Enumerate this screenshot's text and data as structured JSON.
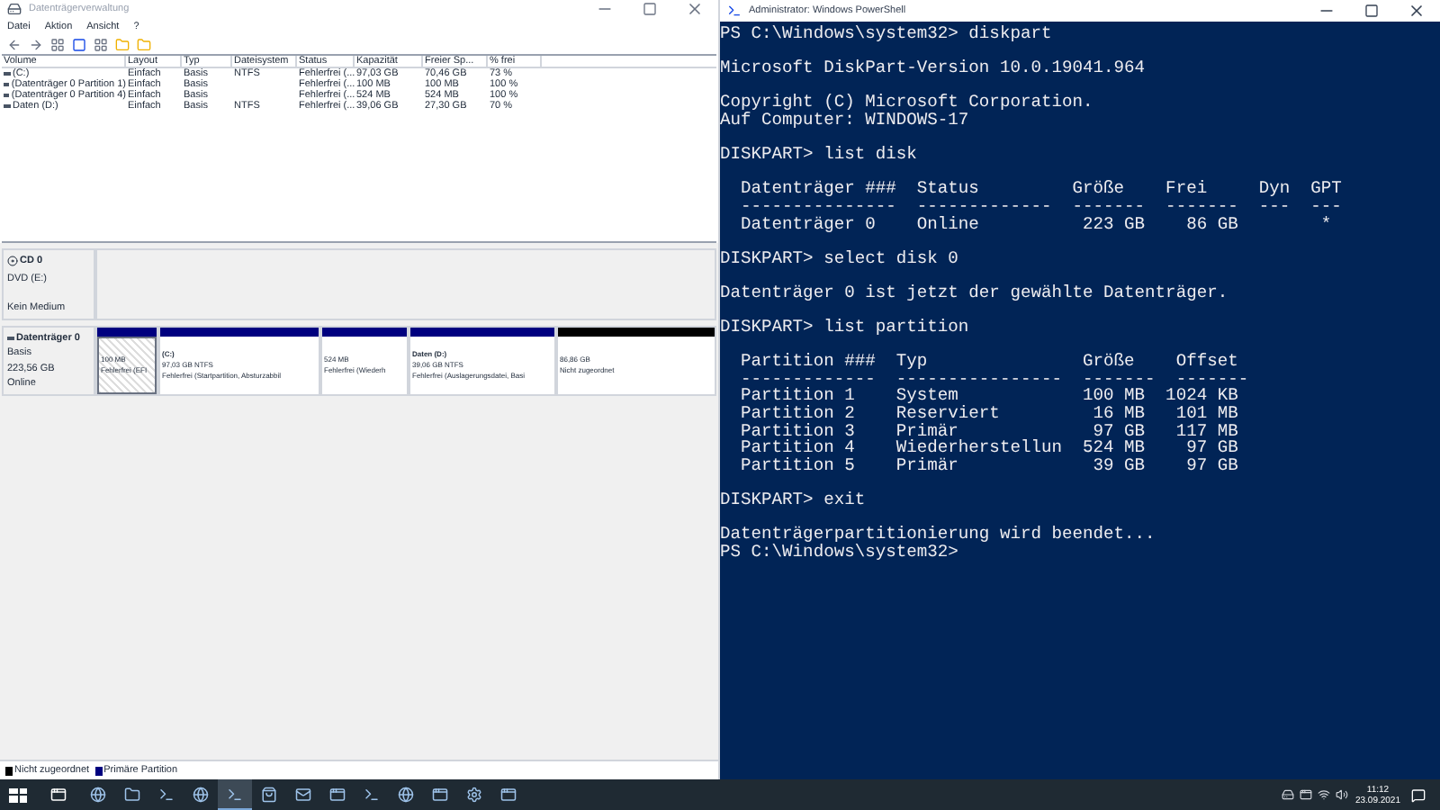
{
  "disk_management": {
    "title": "Datenträgerverwaltung",
    "menu": [
      "Datei",
      "Aktion",
      "Ansicht",
      "?"
    ],
    "columns": [
      "Volume",
      "Layout",
      "Typ",
      "Dateisystem",
      "Status",
      "Kapazität",
      "Freier Sp...",
      "% frei"
    ],
    "rows": [
      [
        "(C:)",
        "Einfach",
        "Basis",
        "NTFS",
        "Fehlerfrei (...",
        "97,03 GB",
        "70,46 GB",
        "73 %"
      ],
      [
        "(Datenträger 0 Partition 1)",
        "Einfach",
        "Basis",
        "",
        "Fehlerfrei (...",
        "100 MB",
        "100 MB",
        "100 %"
      ],
      [
        "(Datenträger 0 Partition 4)",
        "Einfach",
        "Basis",
        "",
        "Fehlerfrei (...",
        "524 MB",
        "524 MB",
        "100 %"
      ],
      [
        "Daten (D:)",
        "Einfach",
        "Basis",
        "NTFS",
        "Fehlerfrei (...",
        "39,06 GB",
        "27,30 GB",
        "70 %"
      ]
    ],
    "disks": [
      {
        "kind": "cd",
        "name": "CD 0",
        "lines": [
          "DVD (E:)",
          "Kein Medium"
        ]
      },
      {
        "kind": "disk",
        "name": "Datenträger 0",
        "lines": [
          "Basis",
          "223,56 GB",
          "Online"
        ],
        "partitions": [
          {
            "selected": true,
            "color": "#00007f",
            "lines": [
              "100 MB",
              "Fehlerfrei (EFI"
            ]
          },
          {
            "selected": false,
            "color": "#00007f",
            "title": "(C:)",
            "lines": [
              "97,03 GB NTFS",
              "Fehlerfrei (Startpartition, Absturzabbil"
            ]
          },
          {
            "selected": false,
            "color": "#00007f",
            "lines": [
              "524 MB",
              "Fehlerfrei (Wiederh"
            ]
          },
          {
            "selected": false,
            "color": "#00007f",
            "title": "Daten (D:)",
            "lines": [
              "39,06 GB NTFS",
              "Fehlerfrei (Auslagerungsdatei, Basi"
            ]
          },
          {
            "selected": false,
            "color": "#000000",
            "lines": [
              "86,86 GB",
              "Nicht zugeordnet"
            ]
          }
        ]
      }
    ],
    "legend": [
      {
        "label": "Nicht zugeordnet",
        "color": "#000000"
      },
      {
        "label": "Primäre Partition",
        "color": "#00007f"
      }
    ]
  },
  "powershell": {
    "title": "Administrator: Windows PowerShell",
    "blocks": [
      [
        "PS C:\\Windows\\system32> diskpart"
      ],
      [
        "Microsoft DiskPart-Version 10.0.19041.964"
      ],
      [
        "Copyright (C) Microsoft Corporation.",
        "Auf Computer: WINDOWS-17"
      ],
      [
        "DISKPART> list disk"
      ],
      [
        "  Datenträger ###  Status         Größe    Frei     Dyn  GPT",
        "  ---------------  -------------  -------  -------  ---  ---",
        "  Datenträger 0    Online          223 GB    86 GB        *"
      ],
      [
        "DISKPART> select disk 0"
      ],
      [
        "Datenträger 0 ist jetzt der gewählte Datenträger."
      ],
      [
        "DISKPART> list partition"
      ],
      [
        "  Partition ###  Typ               Größe    Offset",
        "  -------------  ----------------  -------  -------",
        "  Partition 1    System            100 MB  1024 KB",
        "  Partition 2    Reserviert         16 MB   101 MB",
        "  Partition 3    Primär             97 GB   117 MB",
        "  Partition 4    Wiederherstellun  524 MB    97 GB",
        "  Partition 5    Primär             39 GB    97 GB"
      ],
      [
        "DISKPART> exit"
      ],
      [
        "Datenträgerpartitionierung wird beendet...",
        "PS C:\\Windows\\system32>"
      ]
    ]
  },
  "taskbar": {
    "apps": [
      {
        "kind": "browser",
        "selected": false
      },
      {
        "kind": "folder",
        "selected": false
      },
      {
        "kind": "terminal",
        "selected": false
      },
      {
        "kind": "browser",
        "selected": false
      },
      {
        "kind": "terminal",
        "selected": true
      },
      {
        "kind": "store",
        "selected": false
      },
      {
        "kind": "mail",
        "selected": false
      },
      {
        "kind": "app",
        "selected": false
      },
      {
        "kind": "terminal",
        "selected": false
      },
      {
        "kind": "browser",
        "selected": false
      },
      {
        "kind": "app",
        "selected": false
      },
      {
        "kind": "settings",
        "selected": false
      },
      {
        "kind": "app",
        "selected": false
      }
    ],
    "time": "11:12",
    "date": "23.09.2021"
  }
}
